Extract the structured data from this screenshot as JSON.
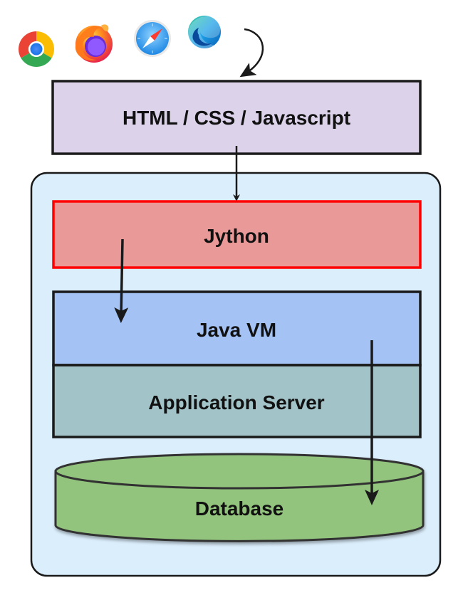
{
  "browsers": [
    {
      "name": "chrome-icon"
    },
    {
      "name": "firefox-icon"
    },
    {
      "name": "safari-icon"
    },
    {
      "name": "edge-icon"
    }
  ],
  "layers": {
    "frontend": "HTML / CSS / Javascript",
    "jython": "Jython",
    "jvm": "Java VM",
    "appserver": "Application Server",
    "database": "Database"
  },
  "colors": {
    "frontend_fill": "#dcd3ea",
    "container_fill": "#dbeefc",
    "jython_fill": "#ea9999",
    "jython_border": "#ff0000",
    "jvm_fill": "#a4c2f4",
    "appserver_fill": "#a2c4c9",
    "database_fill": "#93c47d",
    "stroke": "#1a1a1a"
  }
}
